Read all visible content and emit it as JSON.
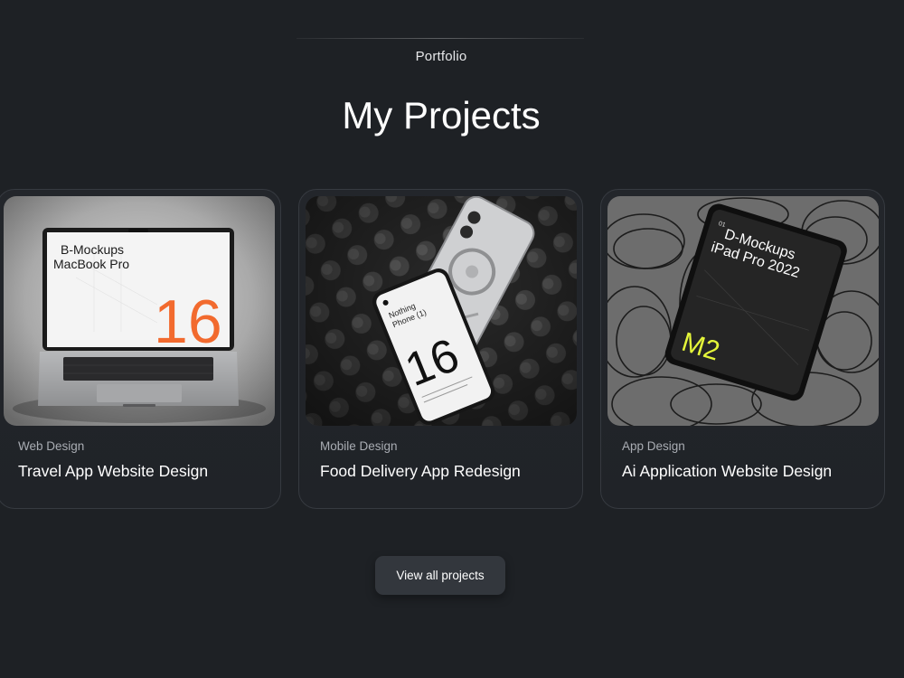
{
  "section": {
    "eyebrow": "Portfolio",
    "title": "My Projects"
  },
  "projects": [
    {
      "category": "Web Design",
      "title": "Travel App Website Design",
      "image": {
        "mockup_name": "B-Mockups",
        "device": "MacBook Pro",
        "number": "16",
        "accent": "#f26a2e"
      }
    },
    {
      "category": "Mobile Design",
      "title": "Food Delivery App Redesign",
      "image": {
        "line1": "Nothing",
        "line2": "Phone (1)",
        "number": "16"
      }
    },
    {
      "category": "App Design",
      "title": "Ai Application Website Design",
      "image": {
        "index": "01",
        "mockup_name": "D-Mockups",
        "device": "iPad Pro 2022",
        "badge": "M2",
        "accent": "#e4f53a"
      }
    }
  ],
  "cta": {
    "label": "View all projects"
  },
  "colors": {
    "background": "#1e2125",
    "card_border": "#363a40",
    "button": "#33373d"
  }
}
